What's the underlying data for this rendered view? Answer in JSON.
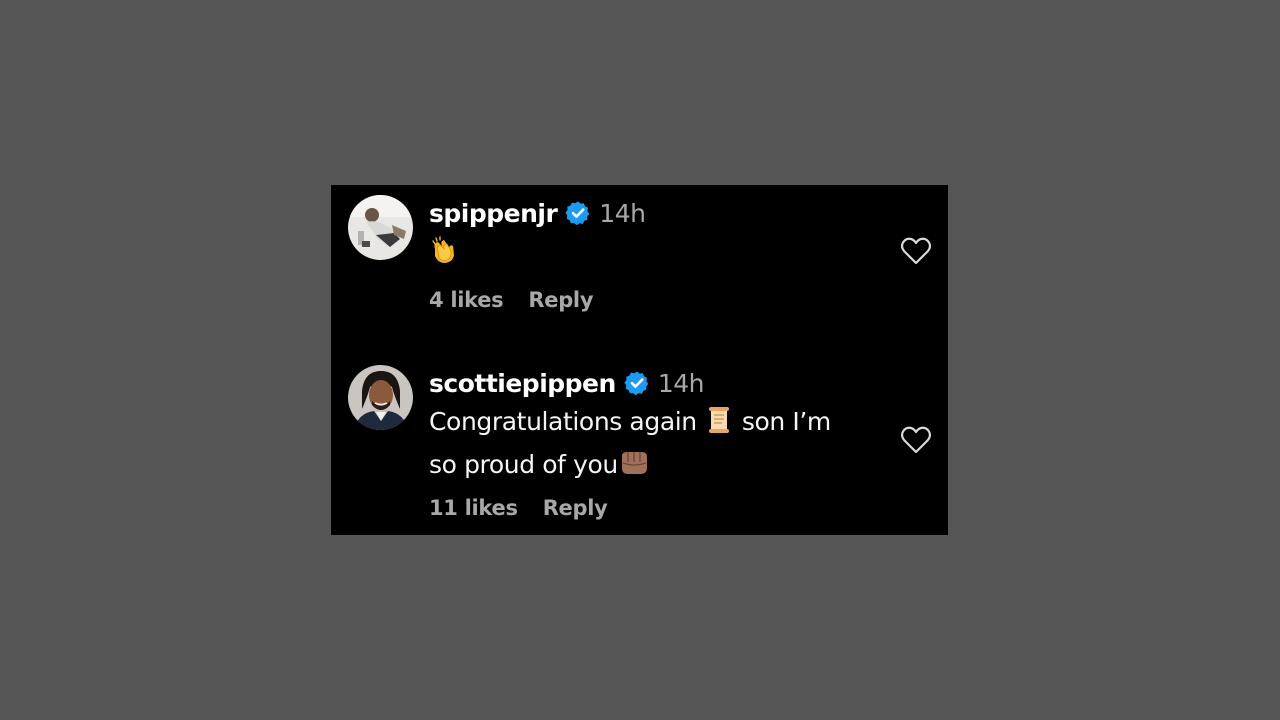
{
  "colors": {
    "page_background": "#555555",
    "panel_background": "#000000",
    "username": "#ffffff",
    "muted_text": "#a8a8a8",
    "verified_badge": "#1d9bf0"
  },
  "comments": [
    {
      "username": "spippenjr",
      "verified": true,
      "verified_icon": "verified-badge-icon",
      "time": "14h",
      "text": "",
      "emoji": "clapping-hands",
      "likes": "4 likes",
      "reply_label": "Reply",
      "like_icon": "heart-outline-icon"
    },
    {
      "username": "scottiepippen",
      "verified": true,
      "verified_icon": "verified-badge-icon",
      "time": "14h",
      "text_part1": "Congratulations again",
      "emoji_1": "scroll",
      "text_part2": "son I’m",
      "text_part3": "so proud of you",
      "emoji_2": "oncoming-fist",
      "likes": "11 likes",
      "reply_label": "Reply",
      "like_icon": "heart-outline-icon"
    }
  ]
}
